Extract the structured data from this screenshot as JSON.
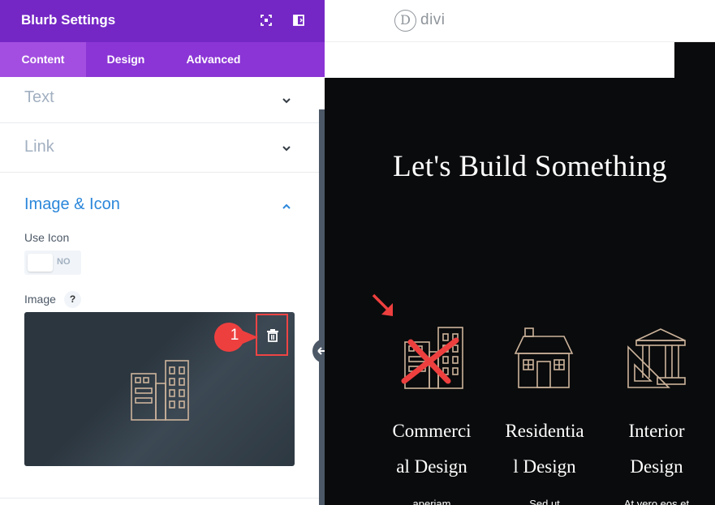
{
  "panel": {
    "title": "Blurb Settings",
    "tabs": [
      {
        "label": "Content",
        "active": true
      },
      {
        "label": "Design",
        "active": false
      },
      {
        "label": "Advanced",
        "active": false
      }
    ],
    "sections": {
      "text": {
        "label": "Text",
        "expanded": false
      },
      "link": {
        "label": "Link",
        "expanded": false
      },
      "image_icon": {
        "label": "Image & Icon",
        "expanded": true,
        "use_icon_label": "Use Icon",
        "use_icon_value": "NO",
        "image_label": "Image",
        "help": "?"
      }
    },
    "step_badge": "1"
  },
  "preview": {
    "logo_letter": "D",
    "logo_text": "divi",
    "headline": "Let's Build Something",
    "blurbs": [
      {
        "title_line1": "Commerci",
        "title_line2": "al Design",
        "text": "aperiam",
        "icon": "office-buildings-icon"
      },
      {
        "title_line1": "Residentia",
        "title_line2": "l Design",
        "text": "Sed ut",
        "icon": "house-icon"
      },
      {
        "title_line1": "Interior",
        "title_line2": "Design",
        "text": "At vero eos et",
        "icon": "columns-ruler-icon"
      }
    ]
  },
  "colors": {
    "header_purple": "#7427c5",
    "tabs_purple": "#8b35d6",
    "active_tab": "#a34ee0",
    "section_blue": "#2b87da",
    "annotation_red": "#ef4444",
    "icon_tan": "#cdb49c",
    "preview_bg": "#0a0b0c"
  }
}
